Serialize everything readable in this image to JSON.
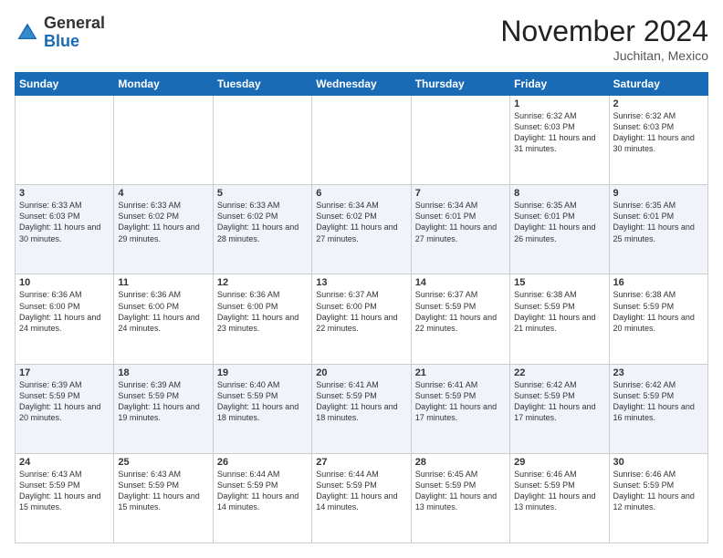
{
  "logo": {
    "general": "General",
    "blue": "Blue"
  },
  "title": "November 2024",
  "subtitle": "Juchitan, Mexico",
  "days": [
    "Sunday",
    "Monday",
    "Tuesday",
    "Wednesday",
    "Thursday",
    "Friday",
    "Saturday"
  ],
  "weeks": [
    [
      {
        "day": "",
        "info": ""
      },
      {
        "day": "",
        "info": ""
      },
      {
        "day": "",
        "info": ""
      },
      {
        "day": "",
        "info": ""
      },
      {
        "day": "",
        "info": ""
      },
      {
        "day": "1",
        "info": "Sunrise: 6:32 AM\nSunset: 6:03 PM\nDaylight: 11 hours and 31 minutes."
      },
      {
        "day": "2",
        "info": "Sunrise: 6:32 AM\nSunset: 6:03 PM\nDaylight: 11 hours and 30 minutes."
      }
    ],
    [
      {
        "day": "3",
        "info": "Sunrise: 6:33 AM\nSunset: 6:03 PM\nDaylight: 11 hours and 30 minutes."
      },
      {
        "day": "4",
        "info": "Sunrise: 6:33 AM\nSunset: 6:02 PM\nDaylight: 11 hours and 29 minutes."
      },
      {
        "day": "5",
        "info": "Sunrise: 6:33 AM\nSunset: 6:02 PM\nDaylight: 11 hours and 28 minutes."
      },
      {
        "day": "6",
        "info": "Sunrise: 6:34 AM\nSunset: 6:02 PM\nDaylight: 11 hours and 27 minutes."
      },
      {
        "day": "7",
        "info": "Sunrise: 6:34 AM\nSunset: 6:01 PM\nDaylight: 11 hours and 27 minutes."
      },
      {
        "day": "8",
        "info": "Sunrise: 6:35 AM\nSunset: 6:01 PM\nDaylight: 11 hours and 26 minutes."
      },
      {
        "day": "9",
        "info": "Sunrise: 6:35 AM\nSunset: 6:01 PM\nDaylight: 11 hours and 25 minutes."
      }
    ],
    [
      {
        "day": "10",
        "info": "Sunrise: 6:36 AM\nSunset: 6:00 PM\nDaylight: 11 hours and 24 minutes."
      },
      {
        "day": "11",
        "info": "Sunrise: 6:36 AM\nSunset: 6:00 PM\nDaylight: 11 hours and 24 minutes."
      },
      {
        "day": "12",
        "info": "Sunrise: 6:36 AM\nSunset: 6:00 PM\nDaylight: 11 hours and 23 minutes."
      },
      {
        "day": "13",
        "info": "Sunrise: 6:37 AM\nSunset: 6:00 PM\nDaylight: 11 hours and 22 minutes."
      },
      {
        "day": "14",
        "info": "Sunrise: 6:37 AM\nSunset: 5:59 PM\nDaylight: 11 hours and 22 minutes."
      },
      {
        "day": "15",
        "info": "Sunrise: 6:38 AM\nSunset: 5:59 PM\nDaylight: 11 hours and 21 minutes."
      },
      {
        "day": "16",
        "info": "Sunrise: 6:38 AM\nSunset: 5:59 PM\nDaylight: 11 hours and 20 minutes."
      }
    ],
    [
      {
        "day": "17",
        "info": "Sunrise: 6:39 AM\nSunset: 5:59 PM\nDaylight: 11 hours and 20 minutes."
      },
      {
        "day": "18",
        "info": "Sunrise: 6:39 AM\nSunset: 5:59 PM\nDaylight: 11 hours and 19 minutes."
      },
      {
        "day": "19",
        "info": "Sunrise: 6:40 AM\nSunset: 5:59 PM\nDaylight: 11 hours and 18 minutes."
      },
      {
        "day": "20",
        "info": "Sunrise: 6:41 AM\nSunset: 5:59 PM\nDaylight: 11 hours and 18 minutes."
      },
      {
        "day": "21",
        "info": "Sunrise: 6:41 AM\nSunset: 5:59 PM\nDaylight: 11 hours and 17 minutes."
      },
      {
        "day": "22",
        "info": "Sunrise: 6:42 AM\nSunset: 5:59 PM\nDaylight: 11 hours and 17 minutes."
      },
      {
        "day": "23",
        "info": "Sunrise: 6:42 AM\nSunset: 5:59 PM\nDaylight: 11 hours and 16 minutes."
      }
    ],
    [
      {
        "day": "24",
        "info": "Sunrise: 6:43 AM\nSunset: 5:59 PM\nDaylight: 11 hours and 15 minutes."
      },
      {
        "day": "25",
        "info": "Sunrise: 6:43 AM\nSunset: 5:59 PM\nDaylight: 11 hours and 15 minutes."
      },
      {
        "day": "26",
        "info": "Sunrise: 6:44 AM\nSunset: 5:59 PM\nDaylight: 11 hours and 14 minutes."
      },
      {
        "day": "27",
        "info": "Sunrise: 6:44 AM\nSunset: 5:59 PM\nDaylight: 11 hours and 14 minutes."
      },
      {
        "day": "28",
        "info": "Sunrise: 6:45 AM\nSunset: 5:59 PM\nDaylight: 11 hours and 13 minutes."
      },
      {
        "day": "29",
        "info": "Sunrise: 6:46 AM\nSunset: 5:59 PM\nDaylight: 11 hours and 13 minutes."
      },
      {
        "day": "30",
        "info": "Sunrise: 6:46 AM\nSunset: 5:59 PM\nDaylight: 11 hours and 12 minutes."
      }
    ]
  ]
}
